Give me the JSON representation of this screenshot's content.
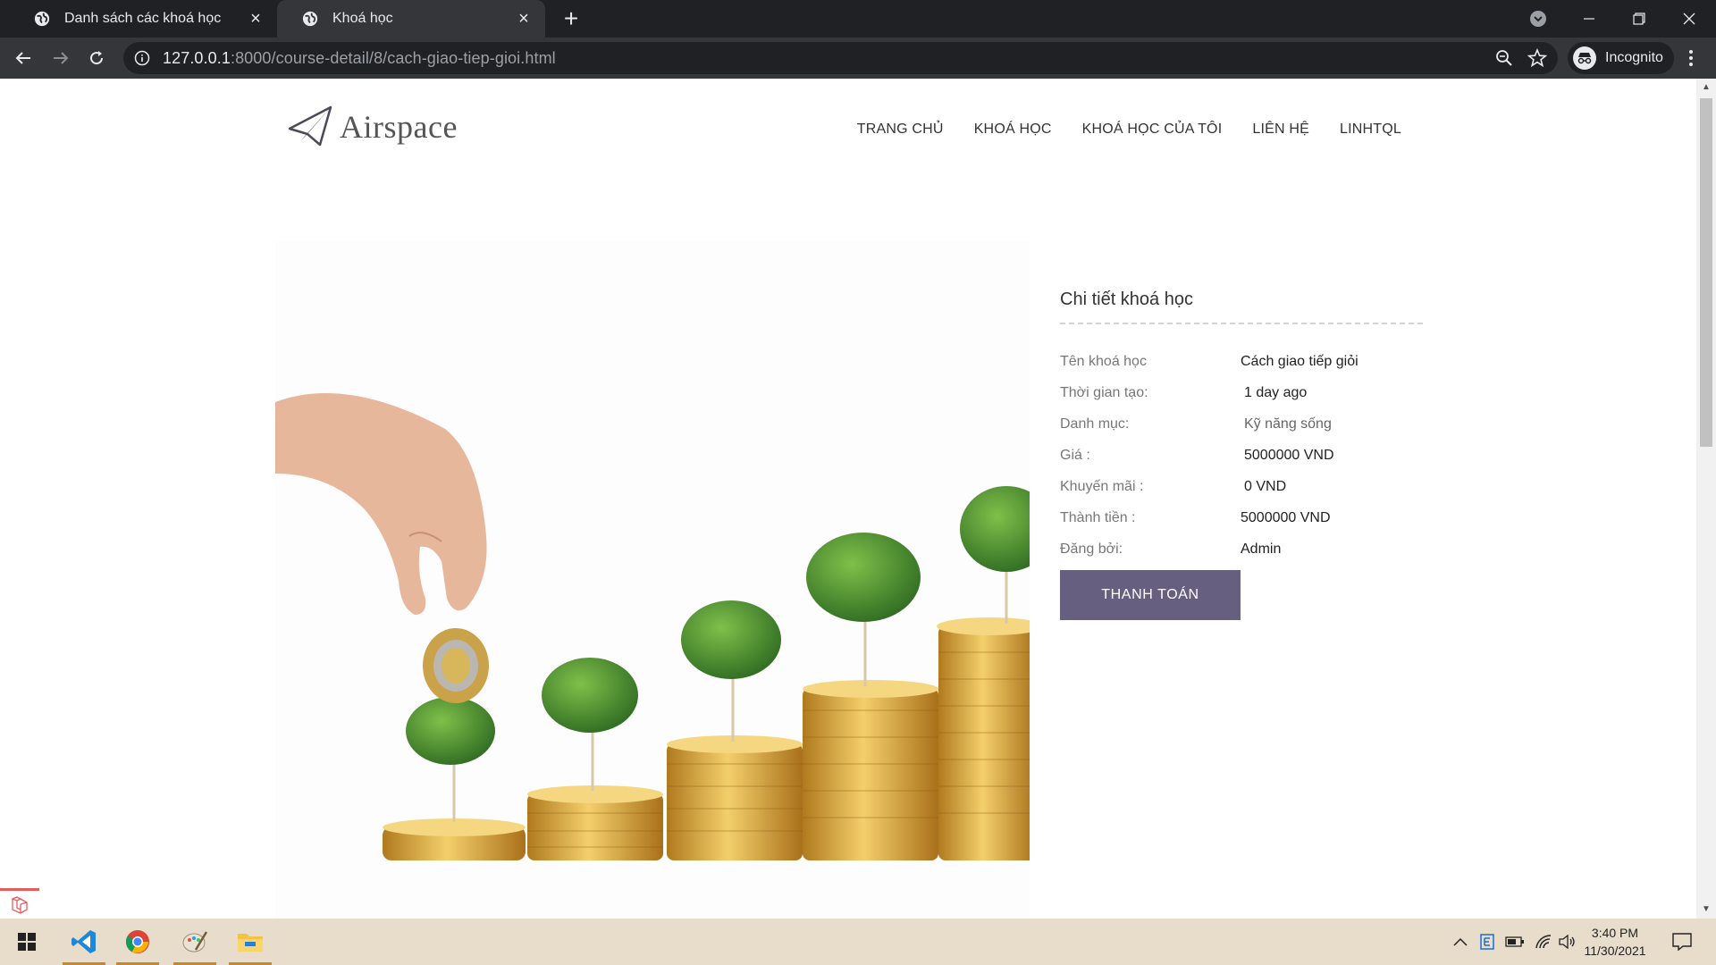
{
  "browser": {
    "tabs": [
      {
        "title": "Danh sách các khoá học",
        "active": false
      },
      {
        "title": "Khoá học",
        "active": true
      }
    ],
    "url_host": "127.0.0.1",
    "url_path": ":8000/course-detail/8/cach-giao-tiep-gioi.html",
    "profile_label": "Incognito"
  },
  "site": {
    "logo_text": "Airspace",
    "nav": [
      "TRANG CHỦ",
      "KHOÁ HỌC",
      "KHOÁ HỌC CỦA TÔI",
      "LIÊN HỆ",
      "LINHTQL"
    ]
  },
  "detail": {
    "heading": "Chi tiết khoá học",
    "rows": [
      {
        "label": "Tên khoá học",
        "value": "Cách giao tiếp giỏi"
      },
      {
        "label": "Thời gian tạo:",
        "value": "1 day ago"
      },
      {
        "label": "Danh mục:",
        "value": "Kỹ năng sống"
      },
      {
        "label": "Giá :",
        "value": "5000000 VND"
      },
      {
        "label": "Khuyến mãi :",
        "value": "0 VND"
      },
      {
        "label": "Thành tiền :",
        "value": "5000000 VND"
      },
      {
        "label": "Đăng bởi:",
        "value": "Admin"
      }
    ],
    "pay_button": "THANH TOÁN"
  },
  "taskbar": {
    "time": "3:40 PM",
    "date": "11/30/2021"
  },
  "colors": {
    "accent": "#665f80",
    "chrome_dark": "#202124",
    "chrome_toolbar": "#35363a",
    "taskbar": "#e8dccb"
  }
}
